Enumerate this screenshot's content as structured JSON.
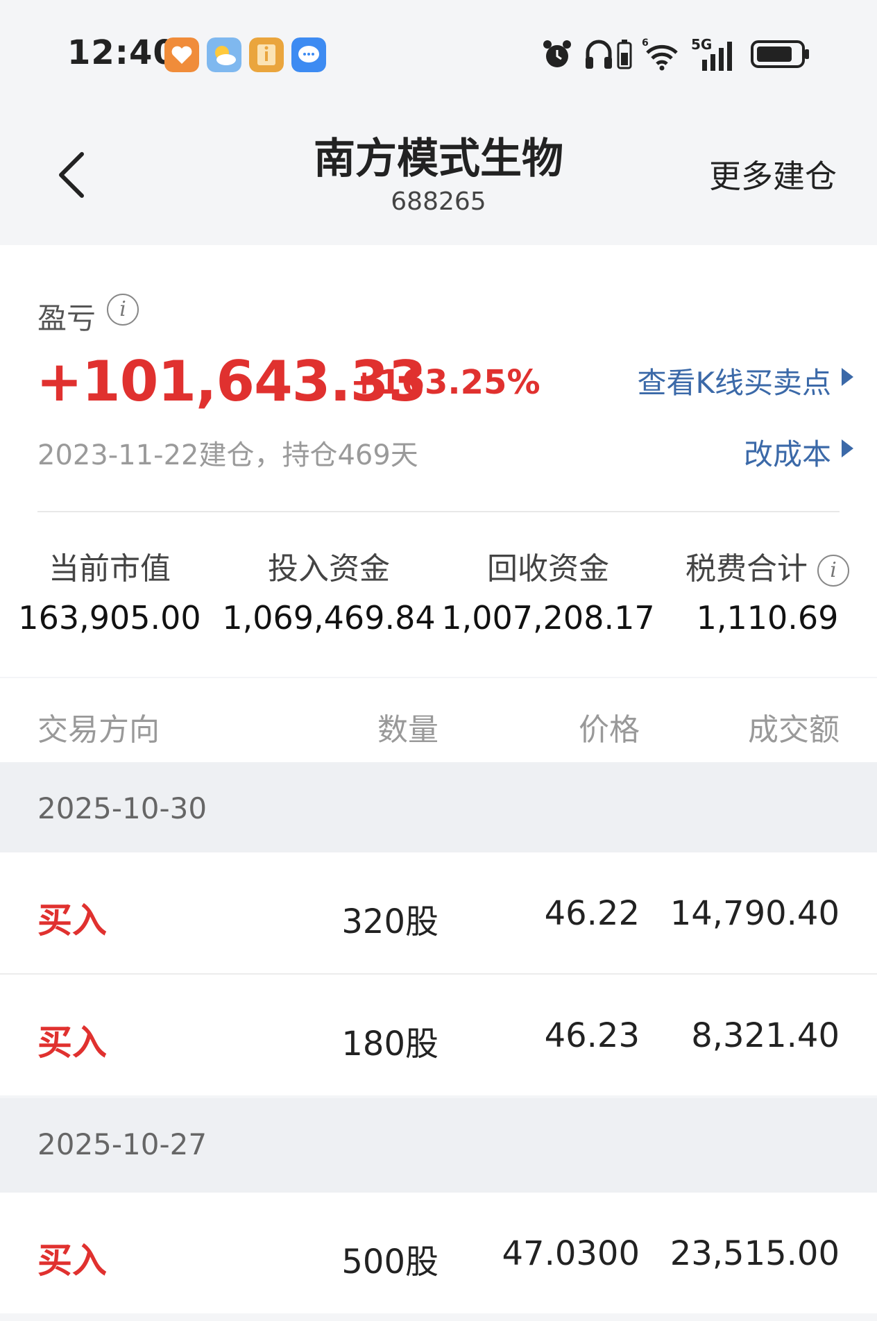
{
  "status_bar": {
    "time": "12:40",
    "app_icons": [
      "heart-app-icon",
      "weather-app-icon",
      "info-app-icon",
      "message-app-icon"
    ],
    "indicators": [
      "alarm-icon",
      "headphones-icon",
      "battery-small-icon",
      "wifi-icon",
      "5g-signal-icon",
      "battery-icon"
    ],
    "network_label": "5G"
  },
  "header": {
    "title": "南方模式生物",
    "code": "688265",
    "more_label": "更多建仓"
  },
  "summary": {
    "pl_label": "盈亏",
    "pl_value": "+101,643.33",
    "pl_pct": "+163.25%",
    "kline_link": "查看K线买卖点",
    "hold_info": "2023-11-22建仓，持仓469天",
    "cost_link": "改成本",
    "metrics": [
      {
        "label": "当前市值",
        "value": "163,905.00"
      },
      {
        "label": "投入资金",
        "value": "1,069,469.84"
      },
      {
        "label": "回收资金",
        "value": "1,007,208.17"
      },
      {
        "label": "税费合计",
        "value": "1,110.69"
      }
    ]
  },
  "table": {
    "headers": [
      "交易方向",
      "数量",
      "价格",
      "成交额"
    ],
    "groups": [
      {
        "date": "2025-10-30",
        "rows": [
          {
            "direction": "买入",
            "qty": "320股",
            "price": "46.22",
            "amount": "14,790.40"
          },
          {
            "direction": "买入",
            "qty": "180股",
            "price": "46.23",
            "amount": "8,321.40"
          }
        ]
      },
      {
        "date": "2025-10-27",
        "rows": [
          {
            "direction": "买入",
            "qty": "500股",
            "price": "47.0300",
            "amount": "23,515.00"
          }
        ]
      }
    ]
  },
  "colors": {
    "gain_red": "#e0312f",
    "link_blue": "#3b69a8",
    "background": "#f4f5f7"
  }
}
